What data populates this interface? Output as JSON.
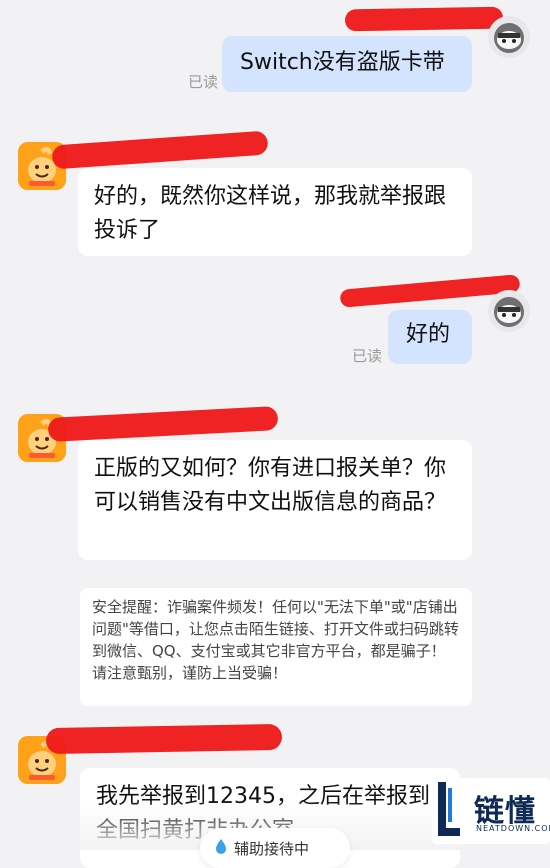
{
  "messages": [
    {
      "sender": "me",
      "text": "Switch没有盗版卡带",
      "status": "已读"
    },
    {
      "sender": "shop",
      "text": "好的，既然你这样说，那我就举报跟投诉了"
    },
    {
      "sender": "me",
      "text": "好的",
      "status": "已读"
    },
    {
      "sender": "shop",
      "text": "正版的又如何？你有进口报关单？你可以销售没有中文出版信息的商品？"
    },
    {
      "sender": "shop",
      "text": "我先举报到12345，之后在举报到全国扫黄打非办公室"
    }
  ],
  "security_notice": "安全提醒：诈骗案件频发！任何以\"无法下单\"或\"店铺出问题\"等借口，让您点击陌生链接、打开文件或扫码跳转到微信、QQ、支付宝或其它非官方平台，都是骗子！请注意甄别，谨防上当受骗！",
  "assist_button_label": "辅助接待中",
  "watermark": {
    "brand": "链懂",
    "site": "NEATDOWN.COM"
  },
  "colors": {
    "outgoing_bubble": "#d4e4ff",
    "incoming_bubble": "#ffffff",
    "background": "#f2f2f4",
    "redaction": "#ee1a1a"
  }
}
